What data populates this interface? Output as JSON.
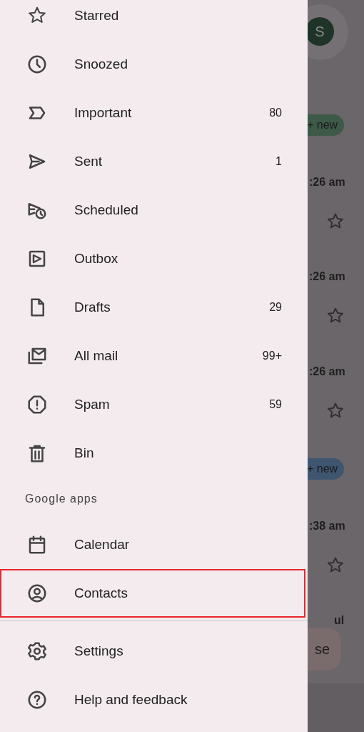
{
  "drawer": {
    "items": [
      {
        "label": "Starred",
        "highlighted": false
      },
      {
        "label": "Snoozed",
        "highlighted": false
      },
      {
        "label": "Important",
        "count": "80",
        "highlighted": false
      },
      {
        "label": "Sent",
        "count": "1",
        "highlighted": false
      },
      {
        "label": "Scheduled",
        "highlighted": false
      },
      {
        "label": "Outbox",
        "highlighted": false
      },
      {
        "label": "Drafts",
        "count": "29",
        "highlighted": false
      },
      {
        "label": "All mail",
        "count": "99+",
        "highlighted": false
      },
      {
        "label": "Spam",
        "count": "59",
        "highlighted": false
      },
      {
        "label": "Bin",
        "highlighted": false
      }
    ],
    "section_title": "Google apps",
    "apps": [
      {
        "label": "Calendar",
        "highlighted": false
      },
      {
        "label": "Contacts",
        "highlighted": true
      }
    ],
    "footer": [
      {
        "label": "Settings"
      },
      {
        "label": "Help and feedback"
      }
    ]
  },
  "background": {
    "avatar": "S",
    "chips": [
      {
        "label": "+ new",
        "color": "#3d5a48"
      },
      {
        "label": "+ new",
        "color": "#3f5670"
      }
    ],
    "times": [
      ":26 am",
      ":26 am",
      ":26 am",
      ":38 am"
    ],
    "fragments": [
      "ul",
      "se"
    ]
  }
}
